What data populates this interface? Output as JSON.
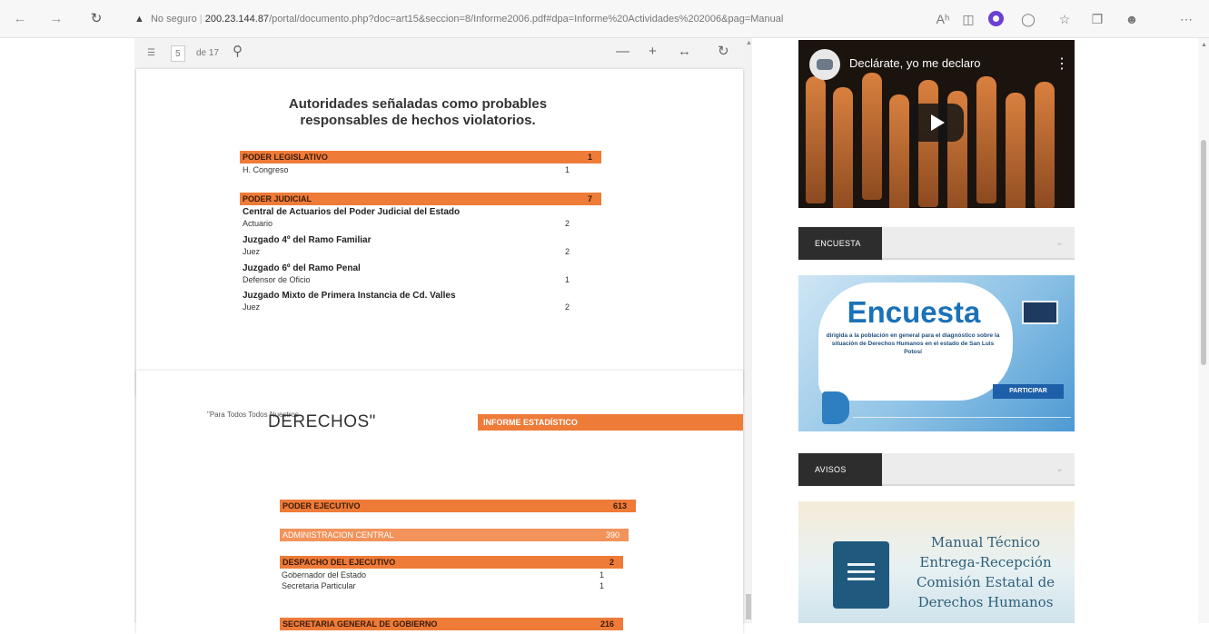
{
  "browser": {
    "security_label": "No seguro",
    "url_host": "200.23.144.87",
    "url_path": "/portal/documento.php?doc=art15&seccion=8/Informe2006.pdf#dpa=Informe%20Actividades%202006&pag=Manual",
    "read_aloud_label": "Aʰ"
  },
  "pdf_toolbar": {
    "page_current": "5",
    "page_total": "de 17",
    "zoom_minus": "—",
    "zoom_plus": "+",
    "fit": "↔"
  },
  "page1": {
    "title": "Autoridades señaladas como probables responsables de hechos violatorios.",
    "sections": [
      {
        "header": "PODER LEGISLATIVO",
        "value": "1",
        "rows": [
          {
            "label": "H. Congreso",
            "value": "1"
          }
        ]
      },
      {
        "header": "PODER JUDICIAL",
        "value": "7",
        "groups": [
          {
            "title": "Central de Actuarios del Poder Judicial del Estado",
            "rows": [
              {
                "label": "Actuario",
                "value": "2"
              }
            ]
          },
          {
            "title": "Juzgado 4º del Ramo Familiar",
            "rows": [
              {
                "label": "Juez",
                "value": "2"
              }
            ]
          },
          {
            "title": "Juzgado 6º del Ramo Penal",
            "rows": [
              {
                "label": "Defensor de Oficio",
                "value": "1"
              }
            ]
          },
          {
            "title": "Juzgado Mixto de Primera Instancia de Cd. Valles",
            "rows": [
              {
                "label": "Juez",
                "value": "2"
              }
            ]
          }
        ]
      }
    ]
  },
  "page2": {
    "slogan_small": "\"Para Todos Todos Nuestros",
    "slogan_big": "DERECHOS\"",
    "informe_label": "INFORME ESTADÍSTICO",
    "poder_ejecutivo": {
      "label": "PODER EJECUTIVO",
      "value": "613"
    },
    "administracion": {
      "label": "ADMINISTRACION CENTRAL",
      "value": "390"
    },
    "despacho": {
      "label": "DESPACHO DEL EJECUTIVO",
      "value": "2"
    },
    "despacho_rows": [
      {
        "label": "Gobernador del Estado",
        "value": "1"
      },
      {
        "label": "Secretaria Particular",
        "value": "1"
      }
    ],
    "secretaria": {
      "label": "SECRETARIA GENERAL DE GOBIERNO",
      "value": "216"
    }
  },
  "sidebar": {
    "video": {
      "title": "Declárate, yo me declaro"
    },
    "encuesta_header": "ENCUESTA",
    "encuesta_banner": {
      "title": "Encuesta",
      "description": "dirigida a la población en general para el diagnóstico sobre la situación de Derechos Humanos en el estado de San Luis Potosí",
      "button": "PARTICIPAR"
    },
    "avisos_header": "AVISOS",
    "manual_banner": {
      "line1": "Manual Técnico",
      "line2": "Entrega-Recepción",
      "line3": "Comisión Estatal de",
      "line4": "Derechos Humanos"
    }
  },
  "colors": {
    "accent_orange": "#ee7b38",
    "dark_tab": "#2d2d2d",
    "brand_blue": "#1a72b8"
  },
  "icons": [
    "back-icon",
    "forward-icon",
    "refresh-icon",
    "warning-icon",
    "read-aloud-icon",
    "extension-icon",
    "favorites-icon",
    "collections-icon",
    "profile-icon",
    "more-icon",
    "search-icon",
    "rotate-icon",
    "play-icon",
    "more-vert-icon",
    "book-icon"
  ]
}
